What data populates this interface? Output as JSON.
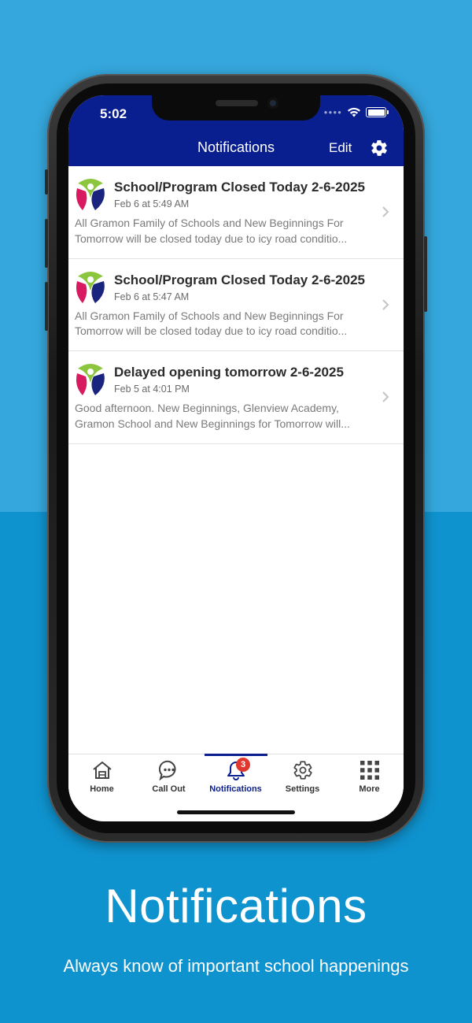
{
  "status_bar": {
    "time": "5:02"
  },
  "header": {
    "title": "Notifications",
    "edit_label": "Edit"
  },
  "notifications": [
    {
      "title": "School/Program Closed Today 2-6-2025",
      "date": "Feb 6 at 5:49 AM",
      "body_line1": "All Gramon Family of Schools and New Beginnings For",
      "body_line2": "Tomorrow will be closed today due to icy road conditio..."
    },
    {
      "title": "School/Program Closed Today 2-6-2025",
      "date": "Feb 6 at 5:47 AM",
      "body_line1": "All Gramon Family of Schools and New Beginnings For",
      "body_line2": "Tomorrow will be closed today due to icy road conditio..."
    },
    {
      "title": "Delayed opening tomorrow 2-6-2025",
      "date": "Feb 5 at 4:01 PM",
      "body_line1": "Good afternoon. New Beginnings, Glenview Academy,",
      "body_line2": "Gramon School and New Beginnings for Tomorrow will..."
    }
  ],
  "tabs": [
    {
      "label": "Home",
      "icon": "home-icon"
    },
    {
      "label": "Call Out",
      "icon": "chat-icon"
    },
    {
      "label": "Notifications",
      "icon": "bell-icon",
      "badge": "3",
      "active": true
    },
    {
      "label": "Settings",
      "icon": "gear-icon"
    },
    {
      "label": "More",
      "icon": "grid-icon"
    }
  ],
  "promo": {
    "title": "Notifications",
    "subtitle": "Always know of important school happenings"
  },
  "colors": {
    "header_bg": "#0a1f8f",
    "bg_top": "#35a7dc",
    "bg_bottom": "#0f93cf",
    "badge": "#e0382e",
    "logo_green": "#8cc63f",
    "logo_pink": "#d81b60",
    "logo_blue": "#1a237e"
  }
}
